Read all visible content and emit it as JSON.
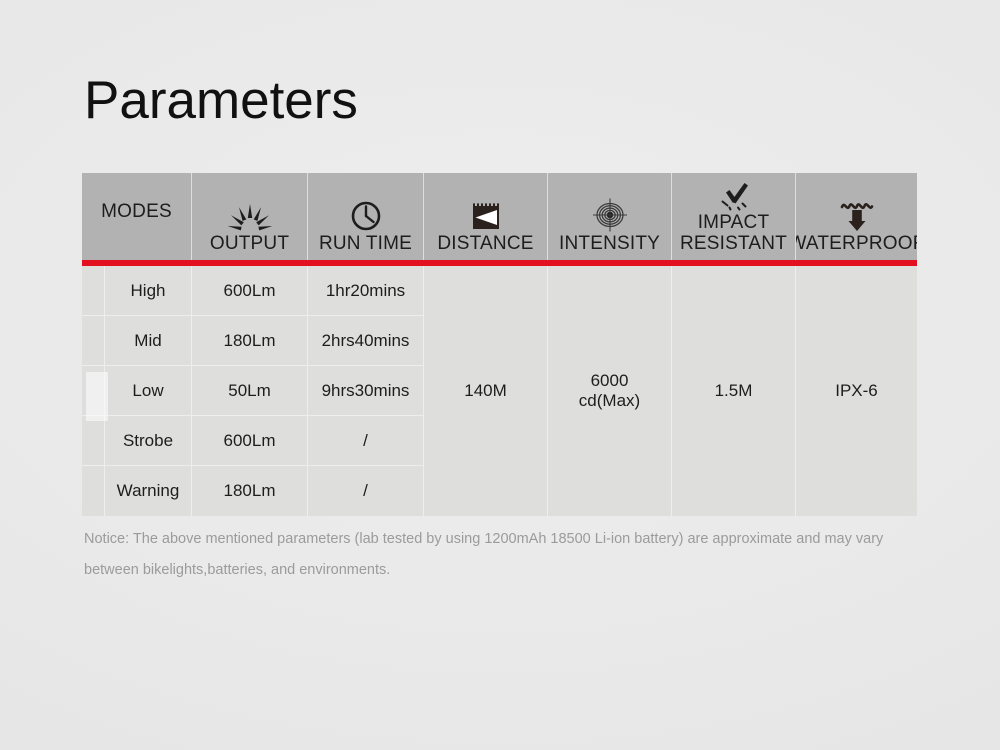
{
  "page": {
    "title": "Parameters",
    "accent_color": "#e3101f",
    "header_bg": "#b2b2b2",
    "cell_bg": "#dededd",
    "page_bg": "#e9e9e9",
    "text_color": "#1d1d1d",
    "notice_color": "#9b9b9b"
  },
  "table": {
    "columns": [
      {
        "label": "MODES",
        "icon": "none"
      },
      {
        "label": "OUTPUT",
        "icon": "sunburst-icon"
      },
      {
        "label": "RUN TIME",
        "icon": "clock-icon"
      },
      {
        "label": "DISTANCE",
        "icon": "beam-distance-icon"
      },
      {
        "label": "INTENSITY",
        "icon": "target-icon"
      },
      {
        "label": "IMPACT\nRESISTANT",
        "icon": "impact-icon"
      },
      {
        "label": "WATERPROOF",
        "icon": "water-drop-arrow-icon"
      }
    ],
    "modes": [
      "High",
      "Mid",
      "Low",
      "Strobe",
      "Warning"
    ],
    "output": [
      "600Lm",
      "180Lm",
      "50Lm",
      "600Lm",
      "180Lm"
    ],
    "run_time": [
      "1hr20mins",
      "2hrs40mins",
      "9hrs30mins",
      "/",
      "/"
    ],
    "merged": {
      "distance": "140M",
      "intensity": "6000\ncd(Max)",
      "impact_resistant": "1.5M",
      "waterproof": "IPX-6"
    }
  },
  "notice": {
    "text": "Notice: The above mentioned parameters (lab tested by using 1200mAh 18500 Li-ion battery) are approximate and may vary between bikelights,batteries, and environments."
  }
}
